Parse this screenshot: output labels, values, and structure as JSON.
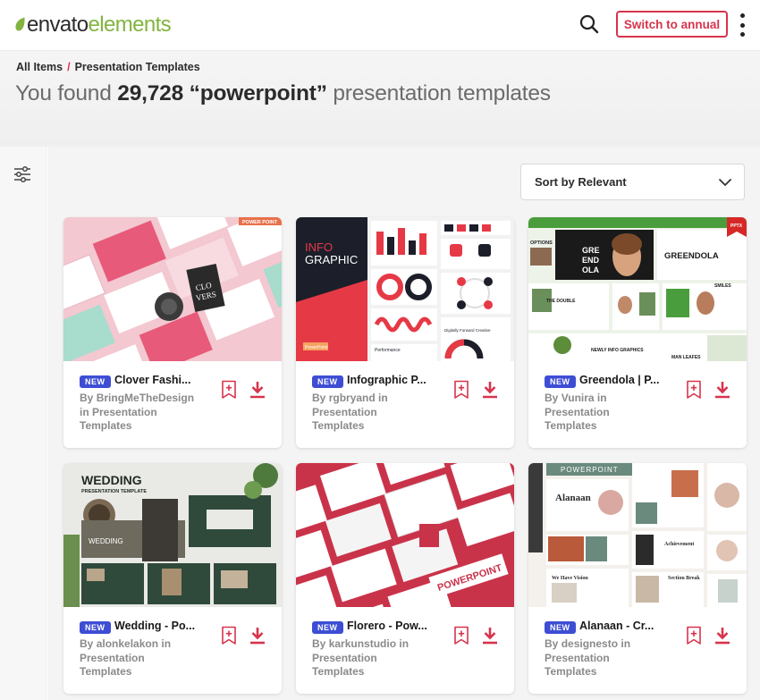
{
  "app": {
    "logo_part1": "envato",
    "logo_part2": "elements",
    "brand_color": "#82b440",
    "accent_color": "#d7344d",
    "badge_color": "#3d4ed4"
  },
  "header": {
    "search_icon": "search-icon",
    "annual_button": "Switch to annual",
    "more_icon": "more-vertical-icon"
  },
  "breadcrumb": {
    "root": "All Items",
    "separator": "/",
    "current": "Presentation Templates"
  },
  "headline": {
    "prefix": "You found",
    "count": "29,728",
    "query": "“powerpoint”",
    "suffix": "presentation templates"
  },
  "sort": {
    "label": "Sort by Relevant"
  },
  "cards": [
    {
      "badge": "NEW",
      "title": "Clover Fashi...",
      "by": "By",
      "author": "BringMeTheDesign",
      "in_prefix": "in Presentation",
      "category_line": "Templates"
    },
    {
      "badge": "NEW",
      "title": "Infographic P...",
      "by": "By",
      "author": "rgbryand in",
      "in_prefix": "Presentation",
      "category_line": "Templates"
    },
    {
      "badge": "NEW",
      "title": "Greendola | P...",
      "by": "By",
      "author": "Vunira in",
      "in_prefix": "Presentation",
      "category_line": "Templates"
    },
    {
      "badge": "NEW",
      "title": "Wedding - Po...",
      "by": "By",
      "author": "alonkelakon in",
      "in_prefix": "Presentation",
      "category_line": "Templates"
    },
    {
      "badge": "NEW",
      "title": "Florero - Pow...",
      "by": "By",
      "author": "karkunstudio in",
      "in_prefix": "Presentation",
      "category_line": "Templates"
    },
    {
      "badge": "NEW",
      "title": "Alanaan - Cr...",
      "by": "By",
      "author": "designesto in",
      "in_prefix": "Presentation",
      "category_line": "Templates"
    }
  ],
  "thumb_text": {
    "t1_a": "CLO",
    "t1_b": "VERS",
    "t1_tag": "POWER POINT",
    "t2_a": "INFO",
    "t2_b": "GRAPHIC",
    "t2_btn": "PowerPoint",
    "t2_perf": "Performance",
    "t2_digital": "Digitally Forward Creative",
    "t3_a": "GRE",
    "t3_b": "END",
    "t3_c": "OLA",
    "t3_name": "GREENDOLA",
    "t3_options": "OPTIONS",
    "t3_smiles": "SMILES",
    "t3_double": "THE DOUBLE",
    "t3_newly": "NEWLY INFO GRAPHICS",
    "t3_man": "MAN LEAFES",
    "t3_tag": "PPTX",
    "t4_a": "WEDDING",
    "t4_b": "PRESENTATION TEMPLATE",
    "t4_c": "WEDDING",
    "t5_a": "POWERPOINT",
    "t6_a": "POWERPOINT",
    "t6_b": "Alanaan",
    "t6_c": "We Have Vision",
    "t6_d": "Achievement",
    "t6_e": "Section Break"
  }
}
